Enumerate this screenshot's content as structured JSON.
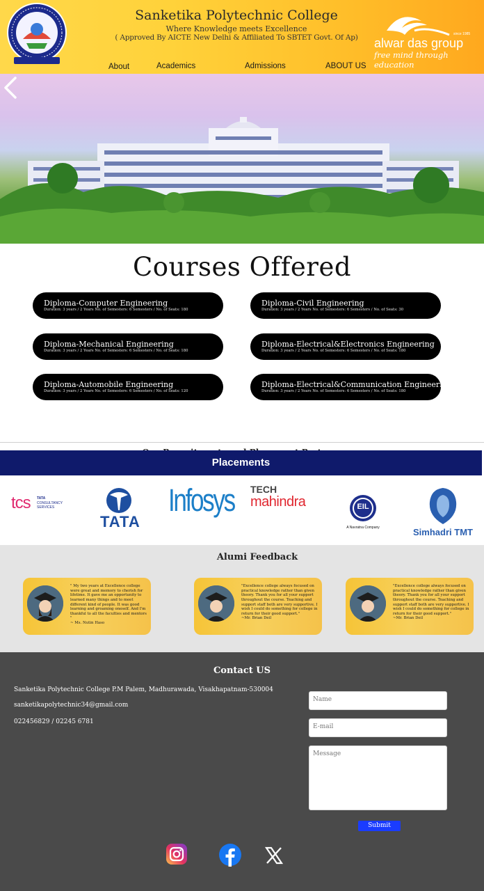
{
  "header": {
    "college_name": "Sanketika Polytechnic College",
    "tagline": "Where Knowledge meets Excellence",
    "approval": "( Approved By AICTE New Delhi & Affiliated To SBTET Govt. Of Ap)",
    "group_name": "alwar das group",
    "group_tagline": "free mind through education",
    "group_since": "since 1985",
    "logo_text": "SANKETIKA POLYTECHNIC COLLEGE"
  },
  "nav": {
    "items": [
      {
        "label": "About"
      },
      {
        "label": "Academics"
      },
      {
        "label": "Admissions"
      },
      {
        "label": "ABOUT US"
      }
    ]
  },
  "hero": {
    "prev_icon": "chevron-left-icon"
  },
  "courses": {
    "title": "Courses Offered",
    "items": [
      {
        "name": "Diploma-Computer Engineering",
        "meta": "Duration: 3 years / 2 Years No. of Semesters: 6 Semesters / No. of Seats: 180"
      },
      {
        "name": "Diploma-Civil Engineering",
        "meta": "Duration: 3 years / 2 Years No. of Semesters: 6 Semesters / No. of Seats: 30"
      },
      {
        "name": "Diploma-Mechanical Engineering",
        "meta": "Duration: 3 years / 2 Years No. of Semesters: 6 Semesters / No. of Seats: 180"
      },
      {
        "name": "Diploma-Electrical&Electronics Engineering",
        "meta": "Duration: 3 years / 2 Years No. of Semesters: 6 Semesters / No. of Seats: 180"
      },
      {
        "name": "Diploma-Automobile Engineering",
        "meta": "Duration: 3 years / 2 Years No. of Semesters: 6 Semesters / No. of Seats: 120"
      },
      {
        "name": "Diploma-Electrical&Communication Engineering",
        "meta": "Duration: 3 years / 2 Years No. of Semesters: 6 Semesters / No. of Seats: 180"
      }
    ]
  },
  "placements": {
    "recruiters_title": "Our Recruitments and Placement Partners",
    "title": "Placements",
    "partners": {
      "tcs": "tcs",
      "tcs_sub1": "TATA",
      "tcs_sub2": "CONSULTANCY",
      "tcs_sub3": "SERVICES",
      "tata": "TATA",
      "infosys": "Infosys",
      "tech": "TECH",
      "mahindra": "mahindra",
      "eil": "EIL",
      "eil_sub": "A Navratna Company",
      "simhadri": "Simhadri TMT"
    }
  },
  "alumni": {
    "title": "Alumi Feedback",
    "cards": [
      {
        "text": "\" My two years at Excellence college were great and memory to cherish for lifetime. It gave me an opportunity to learned many things and to meet different kind of people. It was good learning and groaming oneself. And I'm thankful to all the faculties and mentors \"",
        "author": "~ Ms. Nutin Haso"
      },
      {
        "text": "\"Excellence college always focused on practical knowledge rather than given theory. Thank you for all your support throughout the course. Teaching and support staff both are very supportive. I wish I could do something for college in return for their good support.\"",
        "author": "~Mr. Brian Deil"
      },
      {
        "text": "\"Excellence college always focused on practical knowledge rather than given theory. Thank you for all your support throughout the course. Teaching and support staff both are very supportive. I wish I could do something for college in return for their good support.\"",
        "author": "~Mr. Brian Deil"
      }
    ]
  },
  "contact": {
    "title": "Contact US",
    "address": "Sanketika Polytechnic College P.M Palem, Madhurawada, Visakhapatnam-530004",
    "email": "sanketikapolytechnic34@gmail.com",
    "phone": "022456829 / 02245 6781",
    "form": {
      "name_placeholder": "Name",
      "email_placeholder": "E-mail",
      "message_placeholder": "Message",
      "submit_label": "Submit"
    }
  },
  "social": {
    "icons": [
      "instagram-icon",
      "facebook-icon",
      "x-icon"
    ]
  }
}
